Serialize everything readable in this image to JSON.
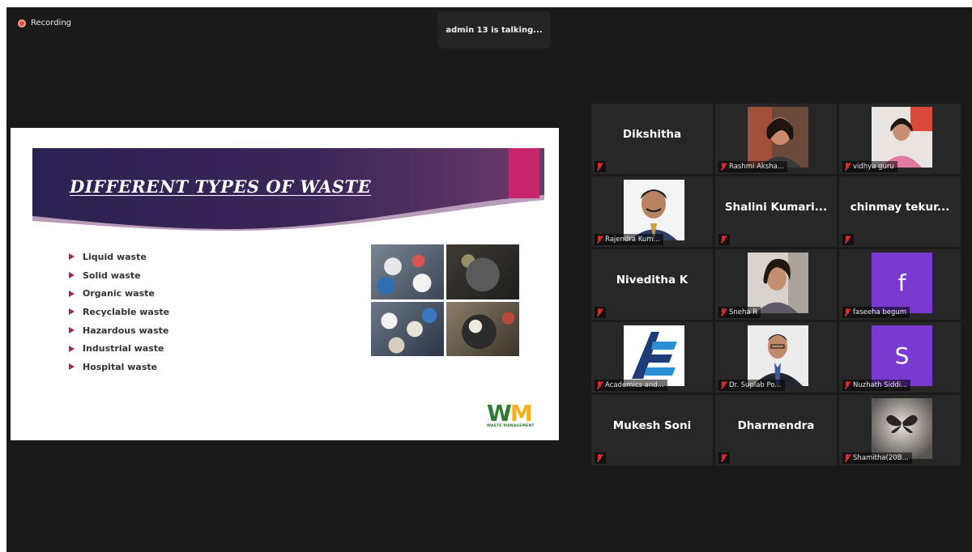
{
  "recording": {
    "label": "Recording"
  },
  "active_speaker": {
    "text": "admin 13 is talking..."
  },
  "slide": {
    "title": "DIFFERENT TYPES OF WASTE",
    "bullets": [
      "Liquid waste",
      "Solid waste",
      "Organic waste",
      "Recyclable waste",
      "Hazardous waste",
      "Industrial waste",
      "Hospital waste"
    ],
    "logo": {
      "mark_w": "W",
      "mark_m": "M",
      "caption": "WASTE MANAGEMENT"
    },
    "colors": {
      "banner_dark": "#2b2150",
      "banner_light": "#6b3a6b",
      "accent_pink": "#c7256c",
      "bullet": "#a3264f"
    }
  },
  "gallery": {
    "participants": [
      {
        "display_name": "Dikshitha",
        "label": "",
        "kind": "name",
        "muted": true
      },
      {
        "display_name": "",
        "label": "Rashmi Aksha...",
        "kind": "video",
        "muted": true
      },
      {
        "display_name": "",
        "label": "vidhya guru",
        "kind": "video",
        "muted": true
      },
      {
        "display_name": "",
        "label": "Rajendra Kum...",
        "kind": "video",
        "muted": true
      },
      {
        "display_name": "Shalini Kumari...",
        "label": "",
        "kind": "name",
        "muted": true
      },
      {
        "display_name": "chinmay tekur...",
        "label": "",
        "kind": "name",
        "muted": true
      },
      {
        "display_name": "Niveditha K",
        "label": "",
        "kind": "name",
        "muted": true
      },
      {
        "display_name": "",
        "label": "Sneha R",
        "kind": "video",
        "muted": true
      },
      {
        "display_name": "",
        "label": "faseeha begum",
        "kind": "avatar",
        "avatar_letter": "f",
        "muted": true
      },
      {
        "display_name": "",
        "label": "Academics and...",
        "kind": "logo",
        "muted": true
      },
      {
        "display_name": "",
        "label": "Dr. Suplab Po...",
        "kind": "video",
        "muted": true
      },
      {
        "display_name": "",
        "label": "Nuzhath Siddi...",
        "kind": "avatar",
        "avatar_letter": "S",
        "muted": true
      },
      {
        "display_name": "Mukesh Soni",
        "label": "",
        "kind": "name",
        "muted": true
      },
      {
        "display_name": "Dharmendra",
        "label": "",
        "kind": "name",
        "muted": true
      },
      {
        "display_name": "",
        "label": "Shamitha(20B...",
        "kind": "video",
        "muted": true
      }
    ]
  }
}
